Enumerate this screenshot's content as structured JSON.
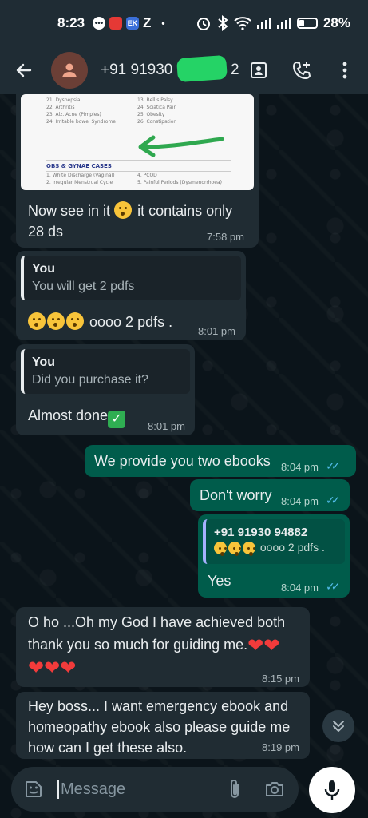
{
  "status_bar": {
    "time": "8:23",
    "carrier_badge": "Z",
    "dot": "•",
    "battery": "28%",
    "battery_level": 0.28
  },
  "header": {
    "contact_name": "+91 91930",
    "contact_suffix": "2",
    "icons": [
      "back-arrow-icon",
      "contact-card-icon",
      "add-call-icon",
      "more-vert-icon"
    ]
  },
  "image_snippet": {
    "rows": [
      [
        "21. Dyspepsia",
        "13. Bell's Palsy"
      ],
      [
        "22. Arthritis",
        "24. Sciatica Pain"
      ],
      [
        "23. Alz. Acne (Pimples)",
        "25. Obesity"
      ],
      [
        "24. Irritable bowel Syndrome",
        "26. Constipation"
      ]
    ],
    "section_title": "OBS & GYNAE CASES",
    "section_rows": [
      [
        "1. White Discharge (Vaginal)",
        "4. PCOD"
      ],
      [
        "2. Irregular Menstrual Cycle",
        "5. Painful Periods (Dysmenorrhoea)"
      ]
    ],
    "arrow_color": "#2fa84f"
  },
  "messages": [
    {
      "id": "m1",
      "dir": "in",
      "text_a": "Now see in it",
      "text_b": "it contains only",
      "text_c": "28 ds",
      "time": "7:58 pm"
    },
    {
      "id": "m2",
      "dir": "in",
      "quote_name": "You",
      "quote_text": "You will get 2 pdfs",
      "text": "oooo 2 pdfs .",
      "time": "8:01 pm"
    },
    {
      "id": "m3",
      "dir": "in",
      "quote_name": "You",
      "quote_text": "Did you purchase it?",
      "text": "Almost done",
      "time": "8:01 pm"
    },
    {
      "id": "m4",
      "dir": "out",
      "text": "We provide you two ebooks",
      "time": "8:04 pm"
    },
    {
      "id": "m5",
      "dir": "out",
      "text": "Don't worry",
      "time": "8:04 pm"
    },
    {
      "id": "m6",
      "dir": "out",
      "quote_name": "+91 91930 94882",
      "quote_text": "oooo 2 pdfs .",
      "text": "Yes",
      "time": "8:04 pm"
    },
    {
      "id": "m7",
      "dir": "in",
      "line1": "O ho ...Oh my God I have achieved both",
      "line2": "thank you so much for guiding me.",
      "time": "8:15 pm"
    },
    {
      "id": "m8",
      "dir": "in",
      "line1": "Hey boss... I want emergency ebook and",
      "line2": "homeopathy  ebook also please guide me",
      "line3": "how can I get these also.",
      "time": "8:19 pm"
    }
  ],
  "composer": {
    "placeholder": "Message",
    "icons": [
      "emoji-icon",
      "attach-icon",
      "camera-icon",
      "mic-icon"
    ]
  },
  "colors": {
    "background": "#0b141a",
    "bar": "#1f2c34",
    "incoming": "#202c33",
    "outgoing": "#005c4b",
    "read_ticks": "#53bdeb"
  }
}
